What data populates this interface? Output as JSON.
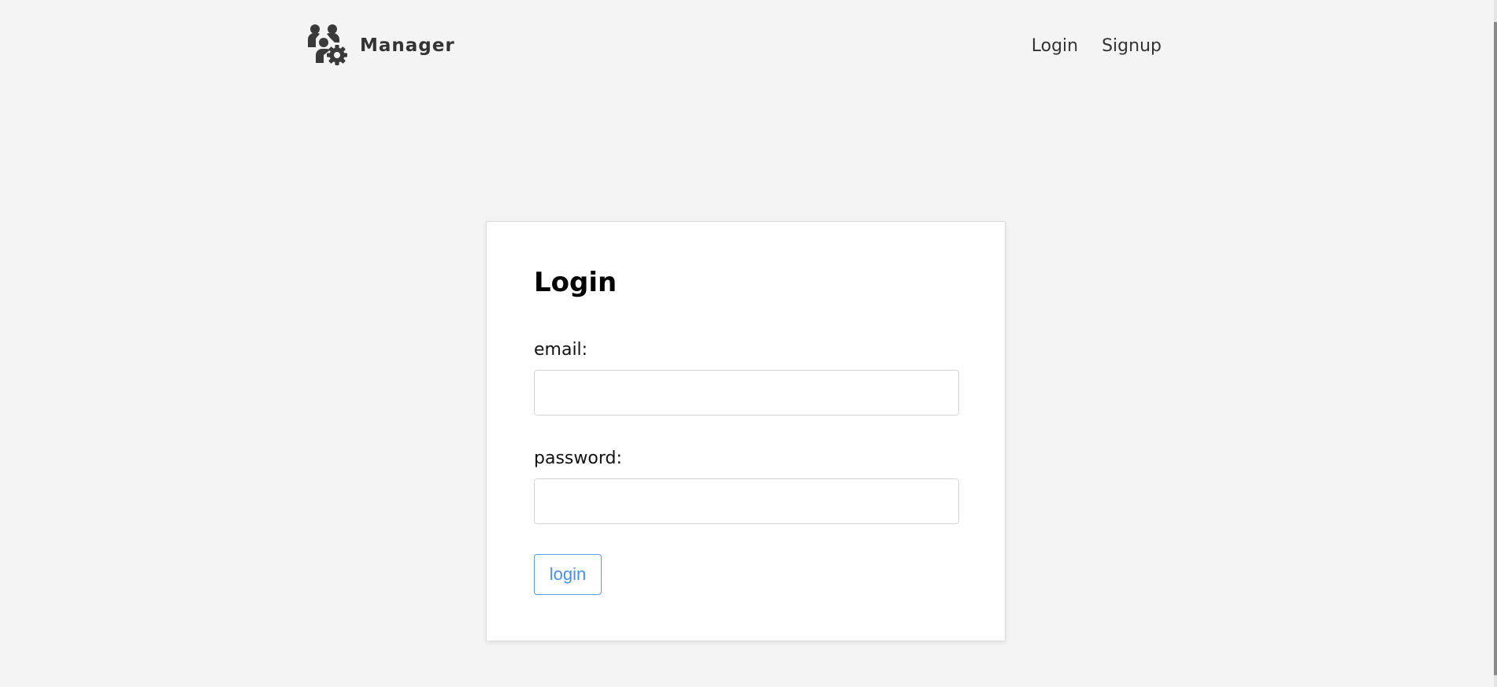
{
  "navbar": {
    "brand_name": "Manager",
    "brand_icon": "users-gear-icon",
    "links": [
      {
        "label": "Login"
      },
      {
        "label": "Signup"
      }
    ]
  },
  "login_form": {
    "title": "Login",
    "email_label": "email:",
    "email_value": "",
    "password_label": "password:",
    "password_value": "",
    "submit_label": "login"
  },
  "colors": {
    "background": "#f4f4f4",
    "card": "#ffffff",
    "text": "#333333",
    "button_accent": "#4a8fe0"
  }
}
